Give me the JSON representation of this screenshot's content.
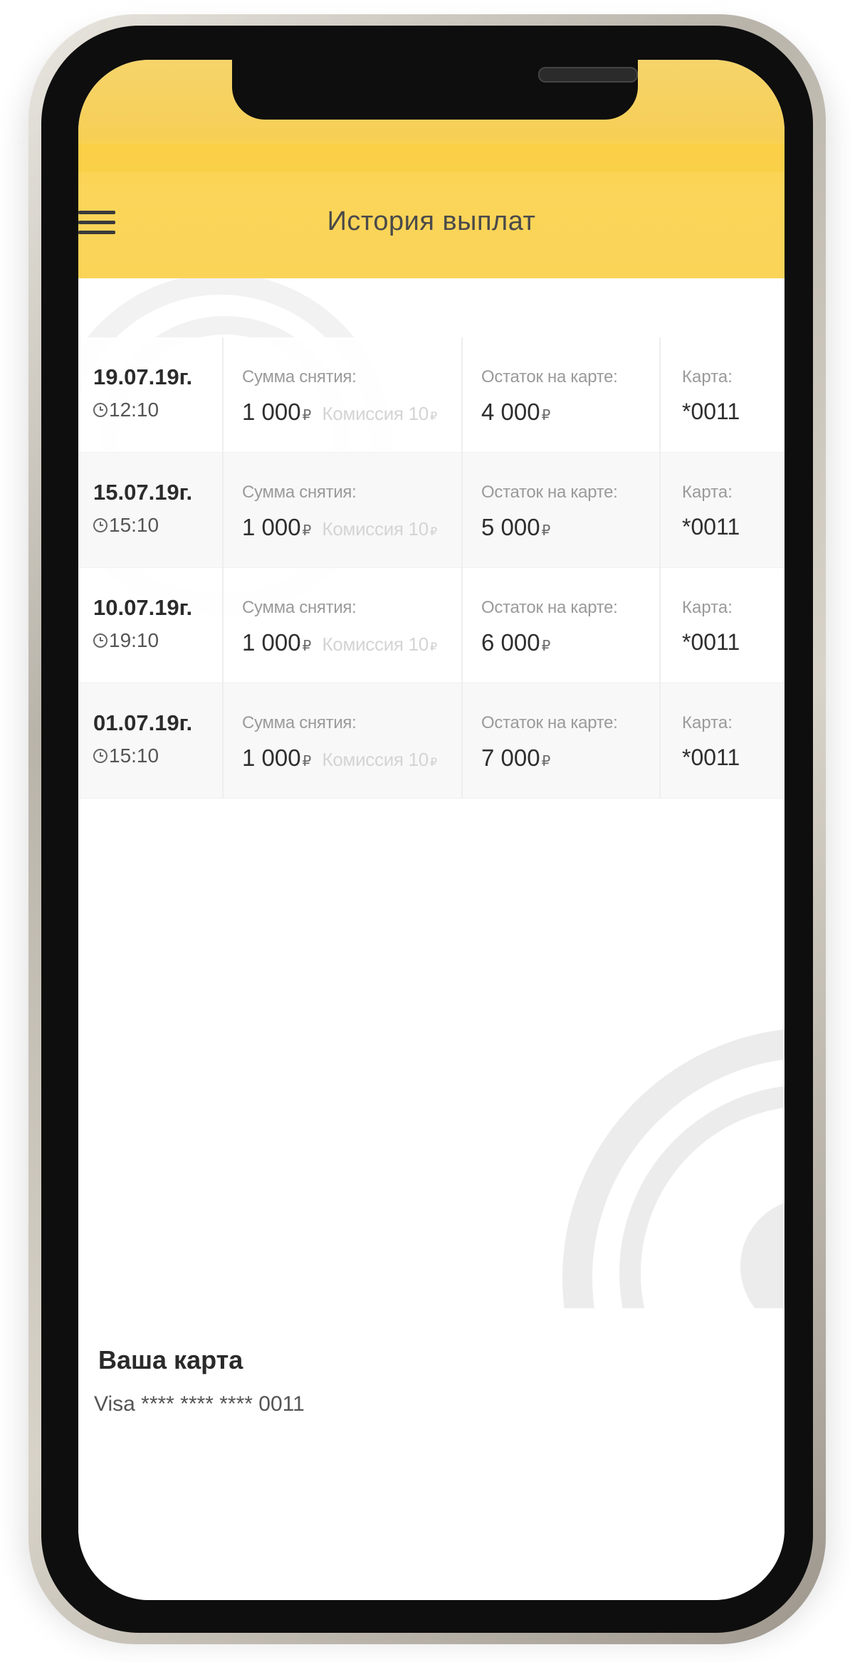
{
  "header": {
    "title": "История выплат"
  },
  "currency_symbol": "₽",
  "labels": {
    "amount": "Сумма снятия:",
    "balance": "Остаток на карте:",
    "card": "Карта:",
    "commission_prefix": "Комиссия 10"
  },
  "payouts": [
    {
      "date": "19.07.19г.",
      "time": "12:10",
      "amount": "1 000",
      "balance": "4 000",
      "card": "*0011"
    },
    {
      "date": "15.07.19г.",
      "time": "15:10",
      "amount": "1 000",
      "balance": "5 000",
      "card": "*0011"
    },
    {
      "date": "10.07.19г.",
      "time": "19:10",
      "amount": "1 000",
      "balance": "6 000",
      "card": "*0011"
    },
    {
      "date": "01.07.19г.",
      "time": "15:10",
      "amount": "1 000",
      "balance": "7 000",
      "card": "*0011"
    }
  ],
  "your_card": {
    "title": "Ваша карта",
    "number": "Visa **** **** **** 0011"
  },
  "colors": {
    "header_yellow": "#fbd250",
    "text_dark": "#2b2b2b",
    "text_muted": "#9a9a9a"
  },
  "icons": {
    "menu": "menu-icon",
    "clock": "clock-icon"
  }
}
